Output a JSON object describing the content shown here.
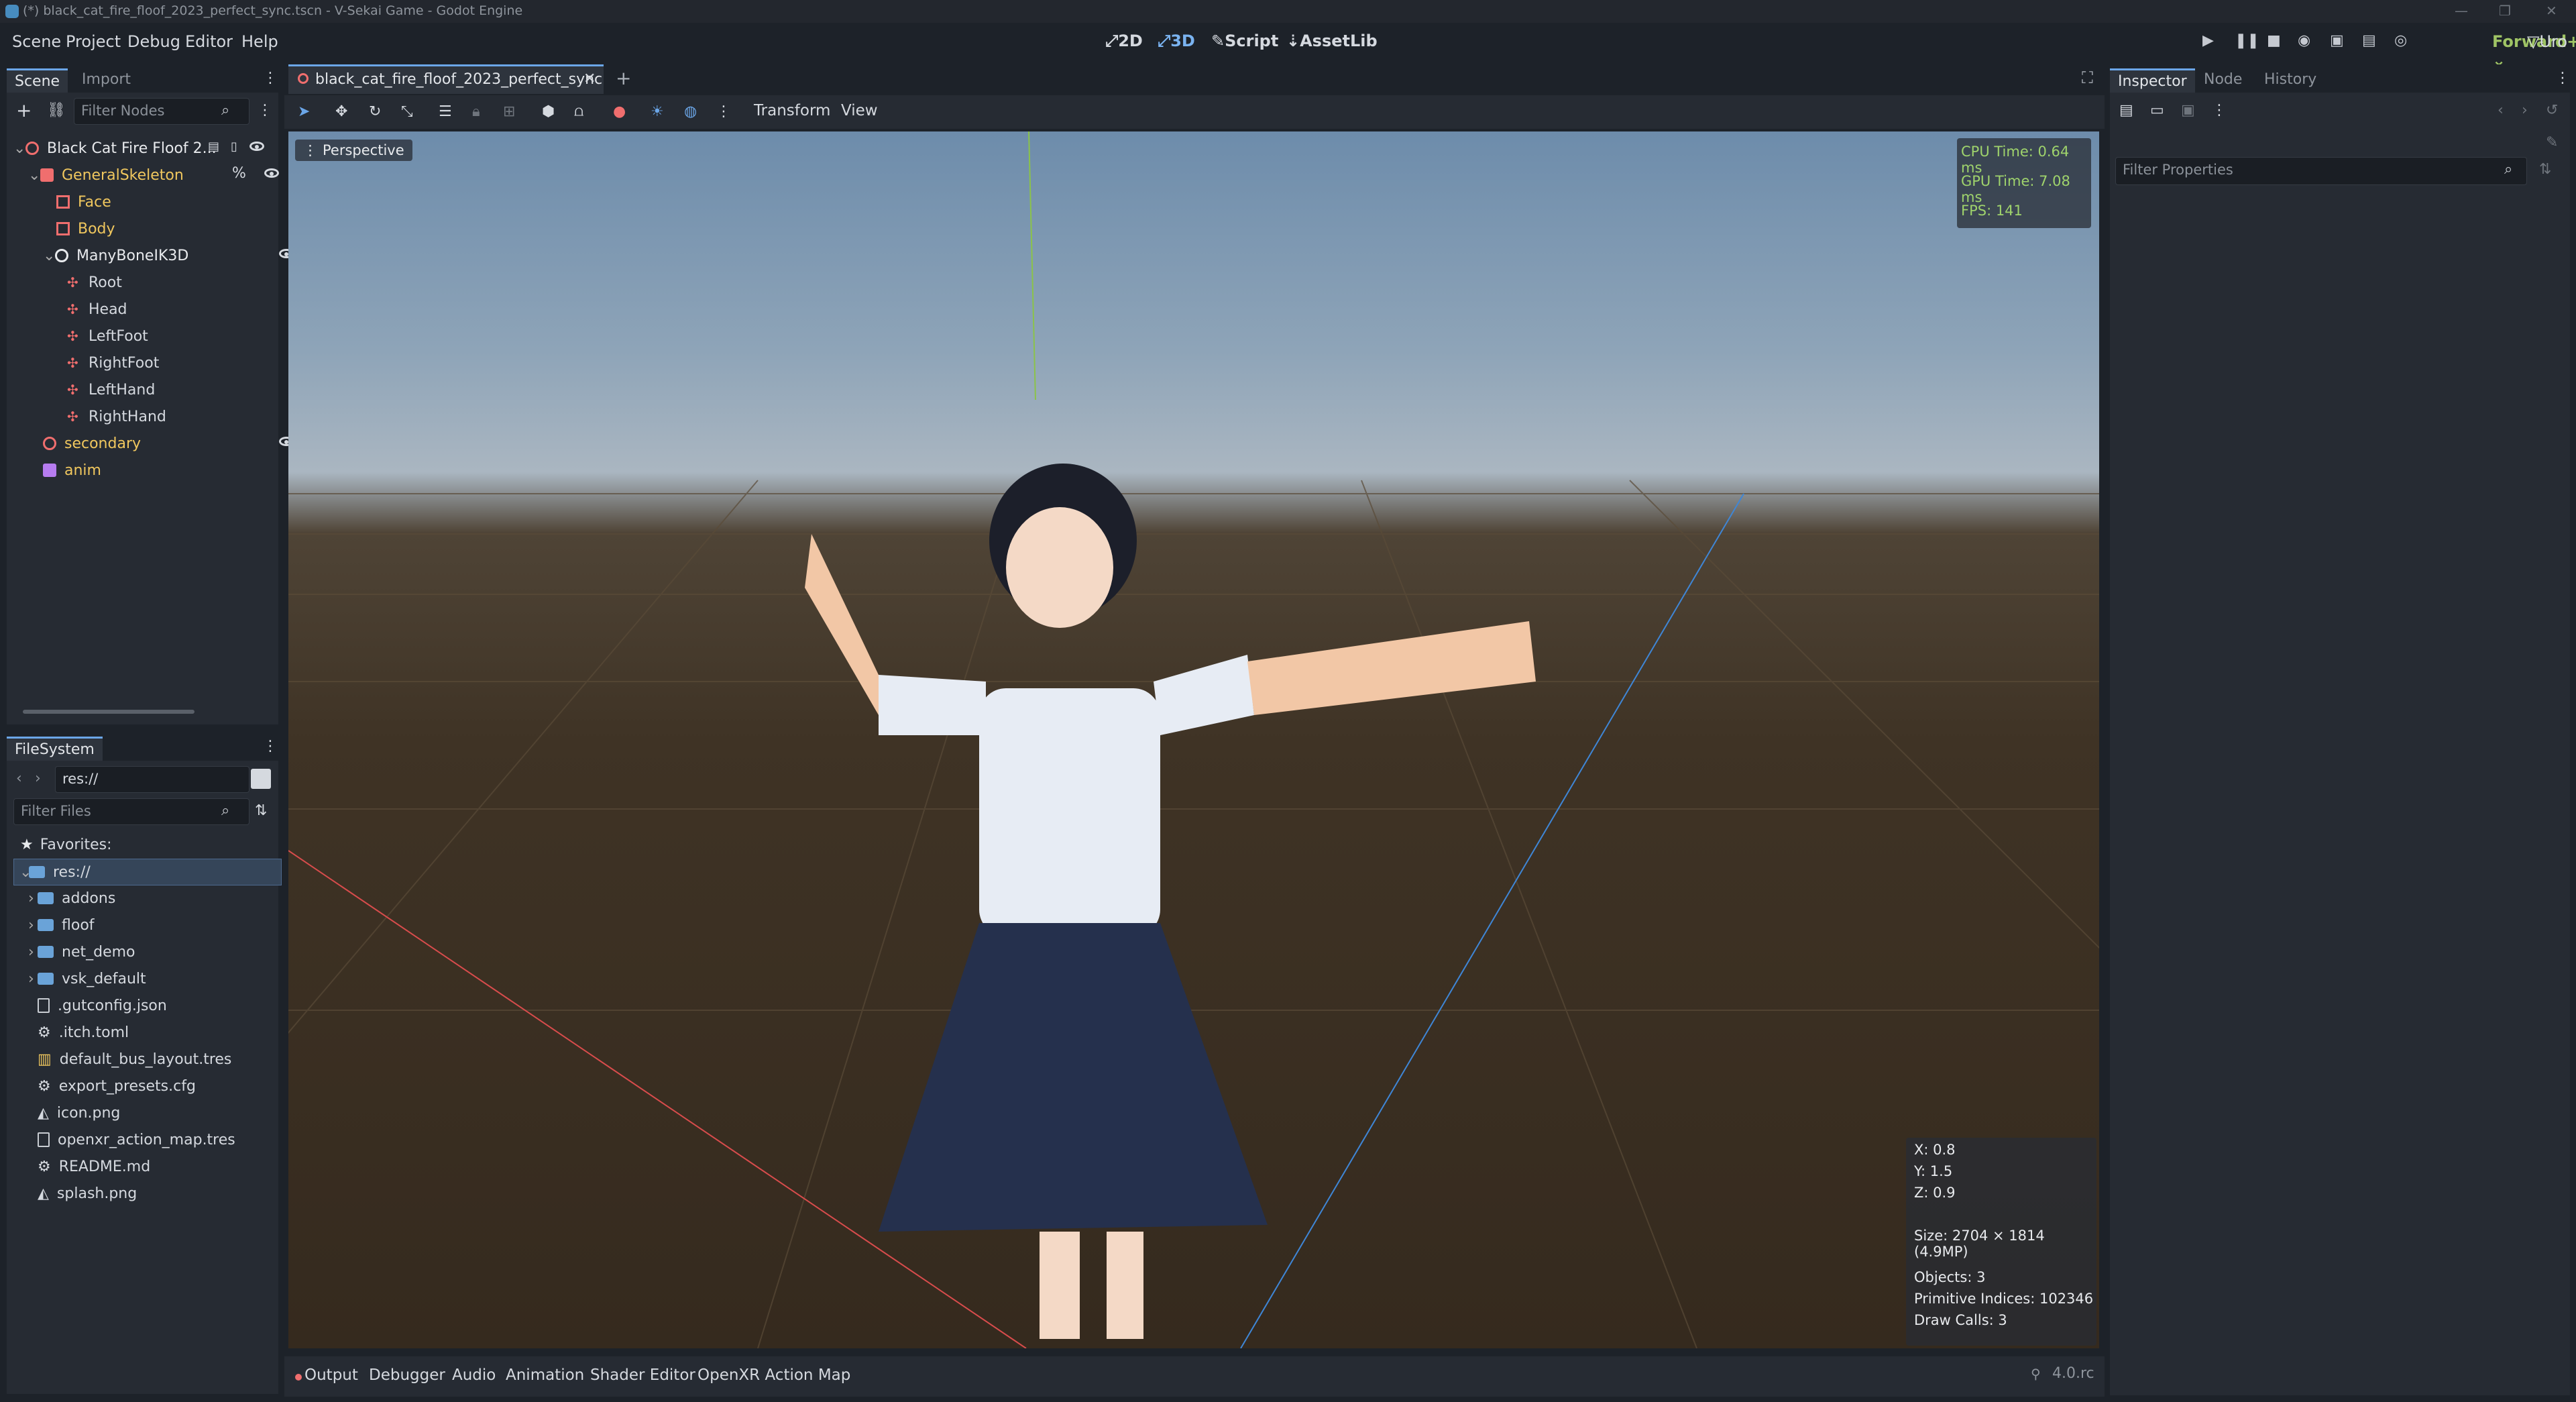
{
  "window": {
    "title": "(*) black_cat_fire_floof_2023_perfect_sync.tscn - V-Sekai Game - Godot Engine"
  },
  "menu": [
    "Scene",
    "Project",
    "Debug",
    "Editor",
    "Help"
  ],
  "workspaces": [
    {
      "label": "2D",
      "icon": "2d-icon",
      "active": false
    },
    {
      "label": "3D",
      "icon": "3d-icon",
      "active": true
    },
    {
      "label": "Script",
      "icon": "script-icon",
      "active": false
    },
    {
      "label": "AssetLib",
      "icon": "assetlib-icon",
      "active": false
    }
  ],
  "renderer": "Forward+",
  "user_button": "Uro",
  "scene_panel": {
    "tabs": [
      "Scene",
      "Import"
    ],
    "filter_placeholder": "Filter Nodes",
    "nodes": [
      {
        "label": "Black Cat Fire Floof 2...",
        "icon": "node3d-icon",
        "color": "#e8eaed",
        "depth": 0
      },
      {
        "label": "GeneralSkeleton",
        "icon": "skeleton-icon",
        "color": "#f0c75e",
        "depth": 1
      },
      {
        "label": "Face",
        "icon": "mesh-icon",
        "color": "#f0c75e",
        "depth": 2
      },
      {
        "label": "Body",
        "icon": "mesh-icon",
        "color": "#f0c75e",
        "depth": 2
      },
      {
        "label": "ManyBoneIK3D",
        "icon": "node3d-white-icon",
        "color": "#e8eaed",
        "depth": 2
      },
      {
        "label": "Root",
        "icon": "bone-icon",
        "color": "#e8eaed",
        "depth": 3
      },
      {
        "label": "Head",
        "icon": "bone-icon",
        "color": "#e8eaed",
        "depth": 3
      },
      {
        "label": "LeftFoot",
        "icon": "bone-icon",
        "color": "#e8eaed",
        "depth": 3
      },
      {
        "label": "RightFoot",
        "icon": "bone-icon",
        "color": "#e8eaed",
        "depth": 3
      },
      {
        "label": "LeftHand",
        "icon": "bone-icon",
        "color": "#e8eaed",
        "depth": 3
      },
      {
        "label": "RightHand",
        "icon": "bone-icon",
        "color": "#e8eaed",
        "depth": 3
      },
      {
        "label": "secondary",
        "icon": "node3d-icon",
        "color": "#f0c75e",
        "depth": 1
      },
      {
        "label": "anim",
        "icon": "animation-player-icon",
        "color": "#f0c75e",
        "depth": 1
      }
    ]
  },
  "filesystem": {
    "tab": "FileSystem",
    "path": "res://",
    "filter_placeholder": "Filter Files",
    "favorites_label": "Favorites:",
    "items": [
      {
        "label": "res://",
        "type": "folder",
        "selected": true
      },
      {
        "label": "addons",
        "type": "folder"
      },
      {
        "label": "floof",
        "type": "folder"
      },
      {
        "label": "net_demo",
        "type": "folder"
      },
      {
        "label": "vsk_default",
        "type": "folder"
      },
      {
        "label": ".gutconfig.json",
        "type": "file"
      },
      {
        "label": ".itch.toml",
        "type": "gear-file"
      },
      {
        "label": "default_bus_layout.tres",
        "type": "bus-file"
      },
      {
        "label": "export_presets.cfg",
        "type": "gear-file"
      },
      {
        "label": "icon.png",
        "type": "image-file"
      },
      {
        "label": "openxr_action_map.tres",
        "type": "file"
      },
      {
        "label": "README.md",
        "type": "gear-file"
      },
      {
        "label": "splash.png",
        "type": "image-file"
      }
    ]
  },
  "editor_tab": {
    "label": "black_cat_fire_floof_2023_perfect_sync"
  },
  "viewport_toolbar": {
    "transform": "Transform",
    "view": "View"
  },
  "viewport": {
    "perspective": "Perspective",
    "stats": {
      "cpu": "CPU Time: 0.64 ms",
      "gpu": "GPU Time: 7.08 ms",
      "fps": "FPS: 141"
    },
    "cursor": {
      "x": "X: 0.8",
      "y": "Y: 1.5",
      "z": "Z: 0.9"
    },
    "size": "Size: 2704 × 1814 (4.9MP)",
    "objects": "Objects: 3",
    "indices": "Primitive Indices: 102346",
    "draw_calls": "Draw Calls: 3"
  },
  "bottom_tabs": [
    "Output",
    "Debugger",
    "Audio",
    "Animation",
    "Shader Editor",
    "OpenXR Action Map"
  ],
  "version": "4.0.rc",
  "inspector": {
    "tabs": [
      "Inspector",
      "Node",
      "History"
    ],
    "filter_placeholder": "Filter Properties"
  },
  "colors": {
    "accent": "#6ba6e8",
    "warning_yellow": "#f0c75e",
    "stat_green": "#9fd36c",
    "renderer_green": "#9fc465"
  }
}
